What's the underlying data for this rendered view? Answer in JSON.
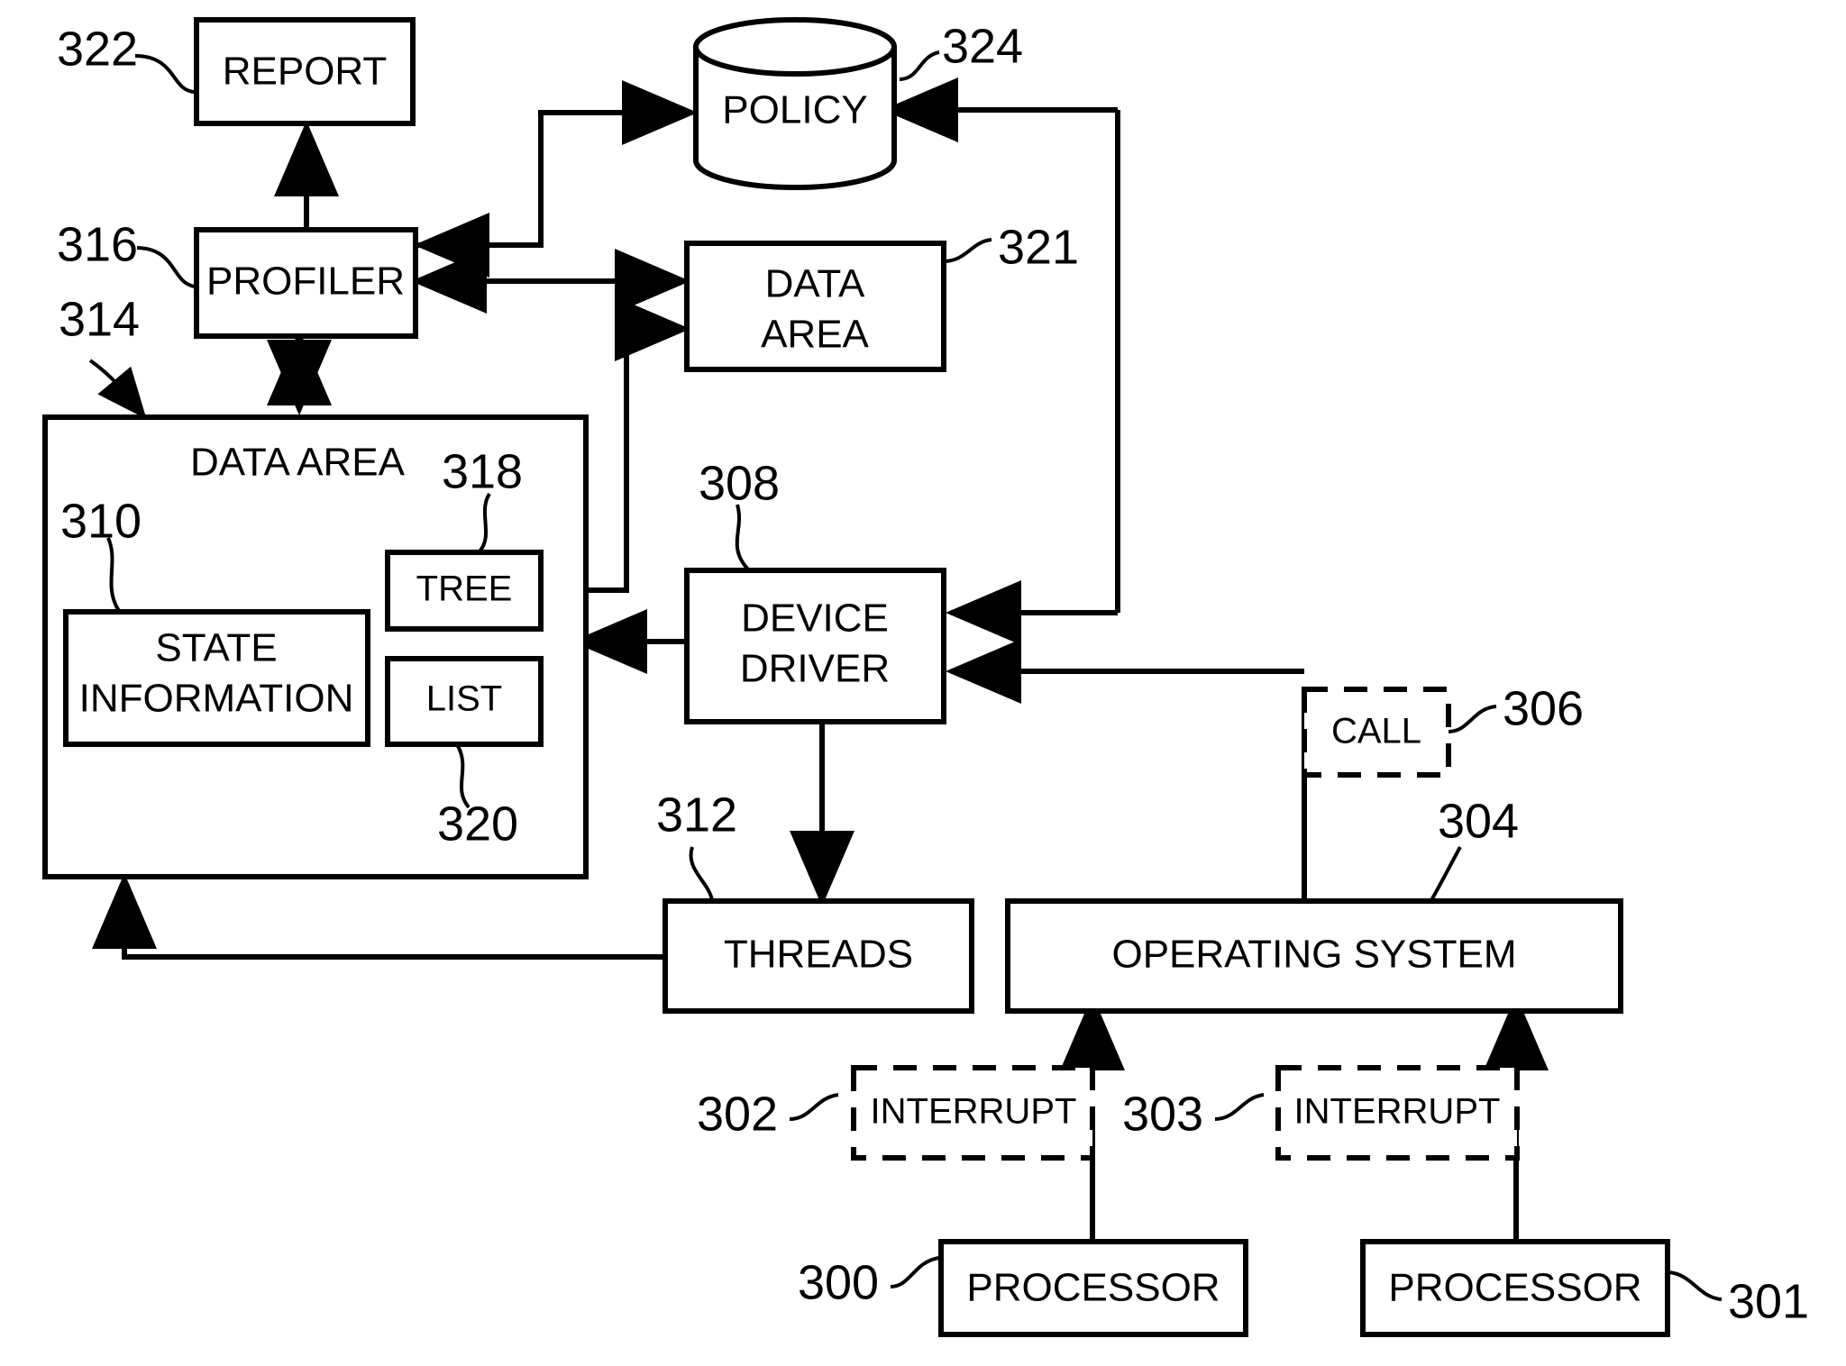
{
  "figure": {
    "kind": "patent-block-diagram",
    "background_color": "#ffffff",
    "stroke_color": "#000000"
  },
  "nodes": {
    "report": {
      "label": "REPORT",
      "ref": "322",
      "shape": "rect"
    },
    "profiler": {
      "label": "PROFILER",
      "ref": "316",
      "shape": "rect"
    },
    "policy": {
      "label": "POLICY",
      "ref": "324",
      "shape": "cylinder"
    },
    "data_area_right": {
      "label_line1": "DATA",
      "label_line2": "AREA",
      "ref": "321",
      "shape": "rect"
    },
    "data_area_main": {
      "label": "DATA AREA",
      "ref": "314",
      "shape": "rect"
    },
    "state_information": {
      "label_line1": "STATE",
      "label_line2": "INFORMATION",
      "ref": "310",
      "shape": "rect"
    },
    "tree": {
      "label": "TREE",
      "ref": "318",
      "shape": "rect"
    },
    "list": {
      "label": "LIST",
      "ref": "320",
      "shape": "rect"
    },
    "device_driver": {
      "label_line1": "DEVICE",
      "label_line2": "DRIVER",
      "ref": "308",
      "shape": "rect"
    },
    "call": {
      "label": "CALL",
      "ref": "306",
      "shape": "rect-dashed"
    },
    "threads": {
      "label": "THREADS",
      "ref": "312",
      "shape": "rect"
    },
    "operating_system": {
      "label": "OPERATING SYSTEM",
      "ref": "304",
      "shape": "rect"
    },
    "interrupt_left": {
      "label": "INTERRUPT",
      "ref": "302",
      "shape": "rect-dashed"
    },
    "interrupt_right": {
      "label": "INTERRUPT",
      "ref": "303",
      "shape": "rect-dashed"
    },
    "processor_left": {
      "label": "PROCESSOR",
      "ref": "300",
      "shape": "rect"
    },
    "processor_right": {
      "label": "PROCESSOR",
      "ref": "301",
      "shape": "rect"
    }
  },
  "reference_numerals": [
    "322",
    "324",
    "316",
    "321",
    "314",
    "310",
    "318",
    "320",
    "308",
    "306",
    "312",
    "304",
    "302",
    "303",
    "300",
    "301"
  ],
  "connections": [
    {
      "from": "profiler",
      "to": "report",
      "arrow": "single"
    },
    {
      "from": "profiler",
      "to": "data_area_main",
      "arrow": "double"
    },
    {
      "from": "profiler",
      "to": "data_area_right",
      "arrow": "double"
    },
    {
      "from": "profiler",
      "to": "policy",
      "arrow": "single-both-ends-split"
    },
    {
      "from": "device_driver",
      "to": "policy",
      "arrow": "single"
    },
    {
      "from": "tree",
      "to": "data_area_right",
      "arrow": "single"
    },
    {
      "from": "device_driver",
      "to": "data_area_main",
      "arrow": "single"
    },
    {
      "from": "call",
      "to": "device_driver",
      "arrow": "single"
    },
    {
      "from": "device_driver",
      "to": "threads",
      "arrow": "single"
    },
    {
      "from": "threads",
      "to": "data_area_main",
      "arrow": "single"
    },
    {
      "from": "operating_system",
      "to": "call",
      "arrow": "line"
    },
    {
      "from": "interrupt_left",
      "to": "operating_system",
      "arrow": "single"
    },
    {
      "from": "interrupt_right",
      "to": "operating_system",
      "arrow": "single"
    },
    {
      "from": "processor_left",
      "to": "interrupt_left",
      "arrow": "line"
    },
    {
      "from": "processor_right",
      "to": "interrupt_right",
      "arrow": "line"
    }
  ]
}
